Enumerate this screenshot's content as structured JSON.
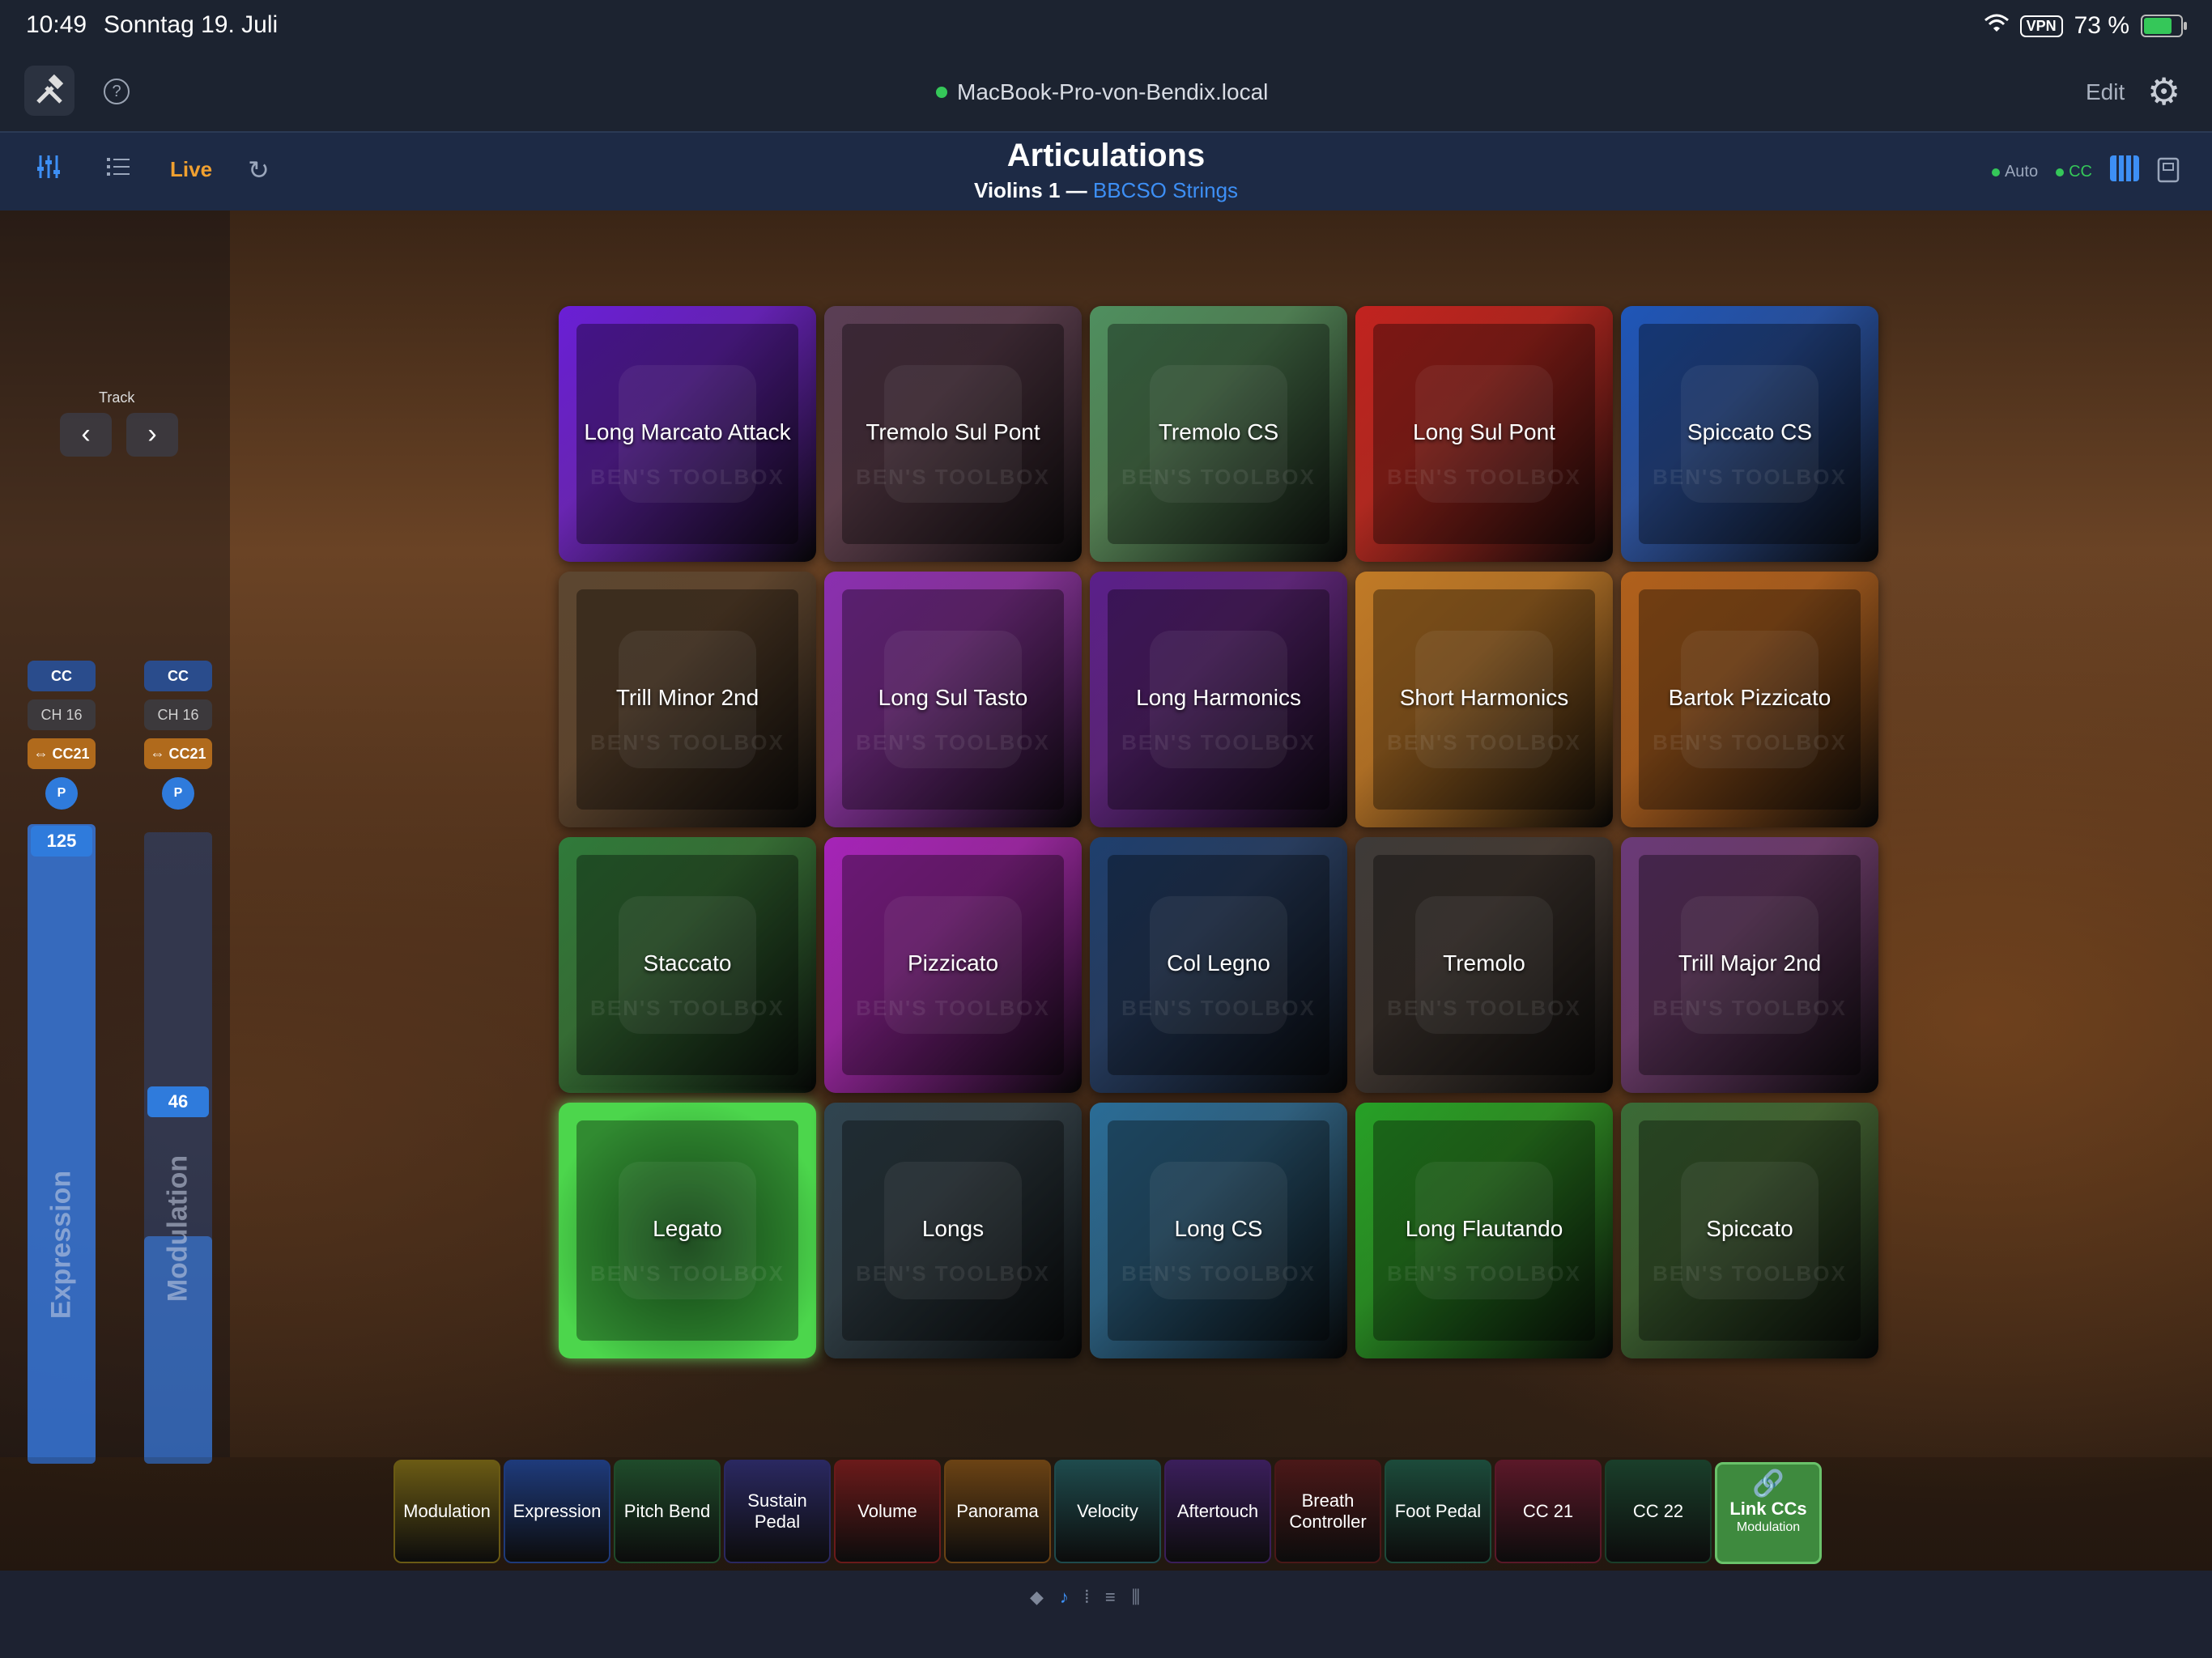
{
  "status_bar": {
    "time": "10:49",
    "date": "Sonntag 19. Juli",
    "vpn": "VPN",
    "battery": "73 %"
  },
  "top": {
    "host": "MacBook-Pro-von-Bendix.local",
    "edit_label": "Edit",
    "help_label": "?"
  },
  "header": {
    "live_label": "Live",
    "title": "Articulations",
    "track_name": "Violins 1",
    "separator": "—",
    "library": "BBCSO Strings",
    "auto_label": "Auto",
    "cc_label": "CC"
  },
  "sidebar": {
    "track_label": "Track",
    "prev": "‹",
    "next": "›",
    "controls": [
      {
        "cc": "CC",
        "channel": "CH 16",
        "mapping": "⇔ CC21",
        "p": "P",
        "value": "125",
        "name": "Expression",
        "level": 1.0
      },
      {
        "cc": "CC",
        "channel": "CH 16",
        "mapping": "⇔ CC21",
        "p": "P",
        "value": "46",
        "name": "Modulation",
        "level": 0.36
      }
    ]
  },
  "articulations": [
    {
      "label": "Long Marcato Attack",
      "color": "#6a1fd6"
    },
    {
      "label": "Tremolo Sul Pont",
      "color": "#5a3e55"
    },
    {
      "label": "Tremolo CS",
      "color": "#4f8f5f"
    },
    {
      "label": "Long Sul Pont",
      "color": "#c2231f"
    },
    {
      "label": "Spiccato CS",
      "color": "#1f56b8"
    },
    {
      "label": "Trill Minor 2nd",
      "color": "#5c4630"
    },
    {
      "label": "Long Sul Tasto",
      "color": "#8a2fb0"
    },
    {
      "label": "Long Harmonics",
      "color": "#5a1f8a"
    },
    {
      "label": "Short Harmonics",
      "color": "#c07a26"
    },
    {
      "label": "Bartok Pizzicato",
      "color": "#b0601c"
    },
    {
      "label": "Staccato",
      "color": "#2f7a3a"
    },
    {
      "label": "Pizzicato",
      "color": "#a524b8"
    },
    {
      "label": "Col Legno",
      "color": "#1e3f6e"
    },
    {
      "label": "Tremolo",
      "color": "#3e3a38"
    },
    {
      "label": "Trill Major 2nd",
      "color": "#6a3a78"
    },
    {
      "label": "Legato",
      "color": "#4cd64c",
      "active": true
    },
    {
      "label": "Longs",
      "color": "#2f4450"
    },
    {
      "label": "Long CS",
      "color": "#2a6c96"
    },
    {
      "label": "Long Flautando",
      "color": "#26a026"
    },
    {
      "label": "Spiccato",
      "color": "#3a6a36"
    }
  ],
  "cc_bar": [
    {
      "label": "Modulation",
      "color": "#6a5a14"
    },
    {
      "label": "Expression",
      "color": "#1e3a7a"
    },
    {
      "label": "Pitch Bend",
      "color": "#1f4a2a"
    },
    {
      "label": "Sustain Pedal",
      "color": "#2a2860"
    },
    {
      "label": "Volume",
      "color": "#6a1a1a"
    },
    {
      "label": "Panorama",
      "color": "#6a4214"
    },
    {
      "label": "Velocity",
      "color": "#1e4a4c"
    },
    {
      "label": "Aftertouch",
      "color": "#3a1e5a"
    },
    {
      "label": "Breath Controller",
      "color": "#4a1818"
    },
    {
      "label": "Foot Pedal",
      "color": "#1c4a3a"
    },
    {
      "label": "CC 21",
      "color": "#5a1828"
    },
    {
      "label": "CC 22",
      "color": "#1a3e2a"
    }
  ],
  "link_ccs": {
    "label": "Link CCs",
    "sub": "Modulation",
    "color": "#3e8a3e"
  },
  "watermark": "BEN'S TOOLBOX"
}
